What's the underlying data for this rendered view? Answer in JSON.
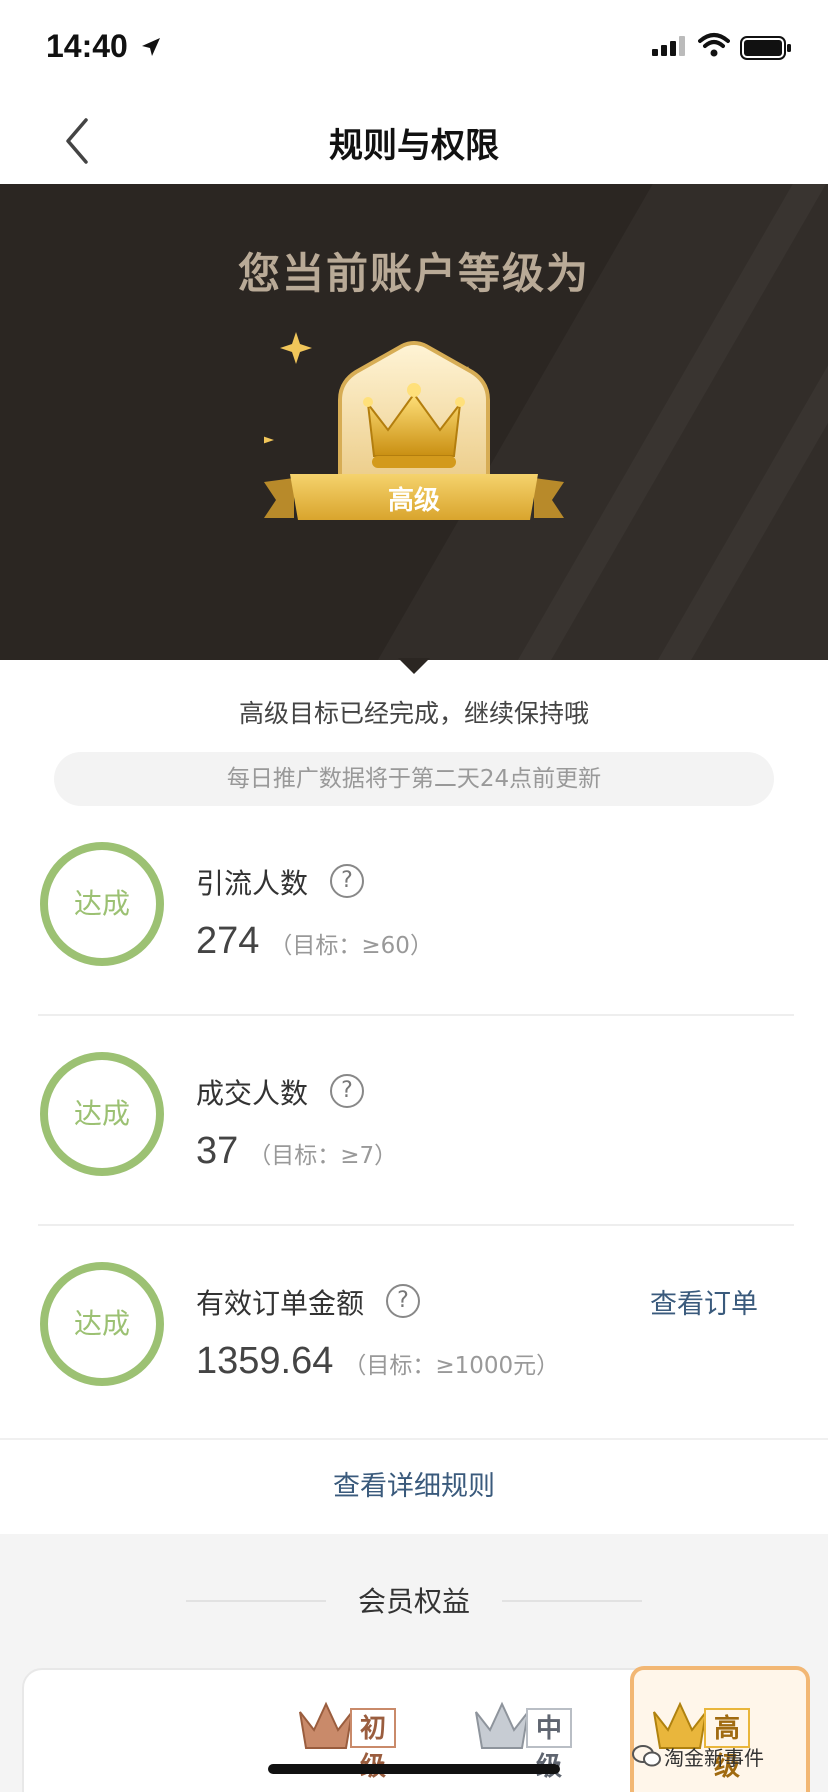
{
  "status_bar": {
    "time": "14:40"
  },
  "nav": {
    "title": "规则与权限"
  },
  "hero": {
    "title": "您当前账户等级为",
    "level_label": "高级"
  },
  "status_message": "高级目标已经完成，继续保持哦",
  "notice": "每日推广数据将于第二天24点前更新",
  "metrics": [
    {
      "badge": "达成",
      "label": "引流人数",
      "value": "274",
      "target": "（目标：≥60）"
    },
    {
      "badge": "达成",
      "label": "成交人数",
      "value": "37",
      "target": "（目标：≥7）"
    },
    {
      "badge": "达成",
      "label": "有效订单金额",
      "value": "1359.64",
      "target": "（目标：≥1000元）",
      "action": "查看订单"
    }
  ],
  "rules_link": "查看详细规则",
  "benefits": {
    "title": "会员权益",
    "tiers": [
      "初级",
      "中级",
      "高级"
    ]
  },
  "watermark": "淘金新事件",
  "colors": {
    "accent_green": "#9cc173",
    "link_blue": "#3a5a7c",
    "hero_bg": "#2b2622",
    "gold": "#f2b774"
  }
}
